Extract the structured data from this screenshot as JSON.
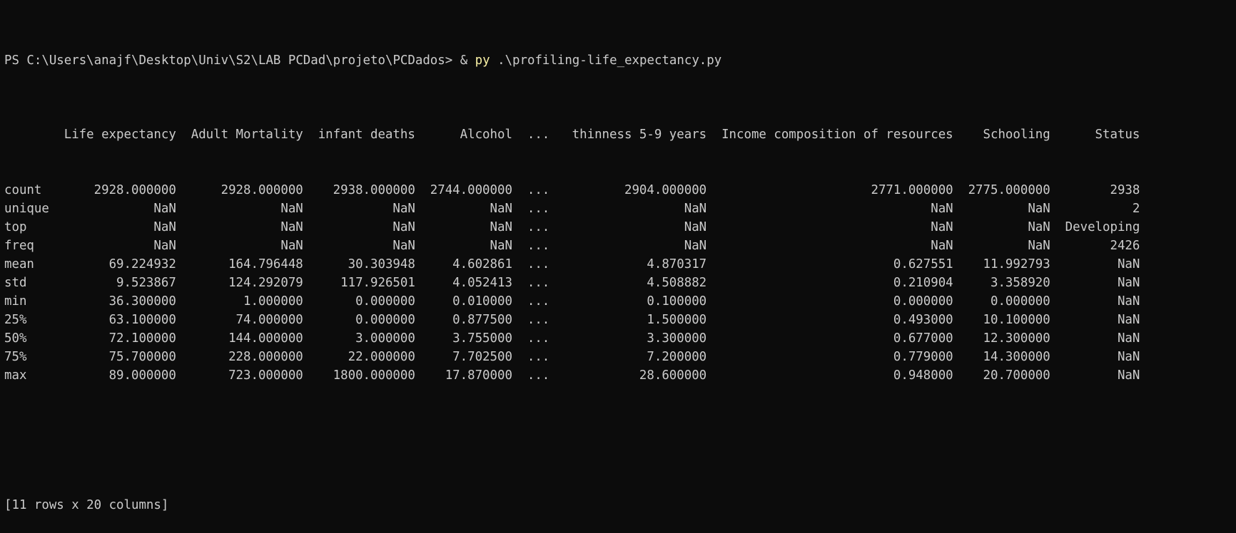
{
  "prompt": {
    "path": "PS C:\\Users\\anajf\\Desktop\\Univ\\S2\\LAB PCDad\\projeto\\PCDados>",
    "operator": "&",
    "command": "py",
    "argument": ".\\profiling-life_expectancy.py"
  },
  "table": {
    "columns": [
      "Life expectancy",
      "Adult Mortality",
      "infant deaths",
      "Alcohol",
      "...",
      "thinness 5-9 years",
      "Income composition of resources",
      "Schooling",
      "Status"
    ],
    "rows": [
      {
        "label": "count",
        "values": [
          "2928.000000",
          "2928.000000",
          "2938.000000",
          "2744.000000",
          "...",
          "2904.000000",
          "2771.000000",
          "2775.000000",
          "2938"
        ]
      },
      {
        "label": "unique",
        "values": [
          "NaN",
          "NaN",
          "NaN",
          "NaN",
          "...",
          "NaN",
          "NaN",
          "NaN",
          "2"
        ]
      },
      {
        "label": "top",
        "values": [
          "NaN",
          "NaN",
          "NaN",
          "NaN",
          "...",
          "NaN",
          "NaN",
          "NaN",
          "Developing"
        ]
      },
      {
        "label": "freq",
        "values": [
          "NaN",
          "NaN",
          "NaN",
          "NaN",
          "...",
          "NaN",
          "NaN",
          "NaN",
          "2426"
        ]
      },
      {
        "label": "mean",
        "values": [
          "69.224932",
          "164.796448",
          "30.303948",
          "4.602861",
          "...",
          "4.870317",
          "0.627551",
          "11.992793",
          "NaN"
        ]
      },
      {
        "label": "std",
        "values": [
          "9.523867",
          "124.292079",
          "117.926501",
          "4.052413",
          "...",
          "4.508882",
          "0.210904",
          "3.358920",
          "NaN"
        ]
      },
      {
        "label": "min",
        "values": [
          "36.300000",
          "1.000000",
          "0.000000",
          "0.010000",
          "...",
          "0.100000",
          "0.000000",
          "0.000000",
          "NaN"
        ]
      },
      {
        "label": "25%",
        "values": [
          "63.100000",
          "74.000000",
          "0.000000",
          "0.877500",
          "...",
          "1.500000",
          "0.493000",
          "10.100000",
          "NaN"
        ]
      },
      {
        "label": "50%",
        "values": [
          "72.100000",
          "144.000000",
          "3.000000",
          "3.755000",
          "...",
          "3.300000",
          "0.677000",
          "12.300000",
          "NaN"
        ]
      },
      {
        "label": "75%",
        "values": [
          "75.700000",
          "228.000000",
          "22.000000",
          "7.702500",
          "...",
          "7.200000",
          "0.779000",
          "14.300000",
          "NaN"
        ]
      },
      {
        "label": "max",
        "values": [
          "89.000000",
          "723.000000",
          "1800.000000",
          "17.870000",
          "...",
          "28.600000",
          "0.948000",
          "20.700000",
          "NaN"
        ]
      }
    ]
  },
  "summary": "[11 rows x 20 columns]",
  "colors": {
    "background": "#0c0c0c",
    "text": "#cccccc",
    "command": "#f9f1a5"
  }
}
